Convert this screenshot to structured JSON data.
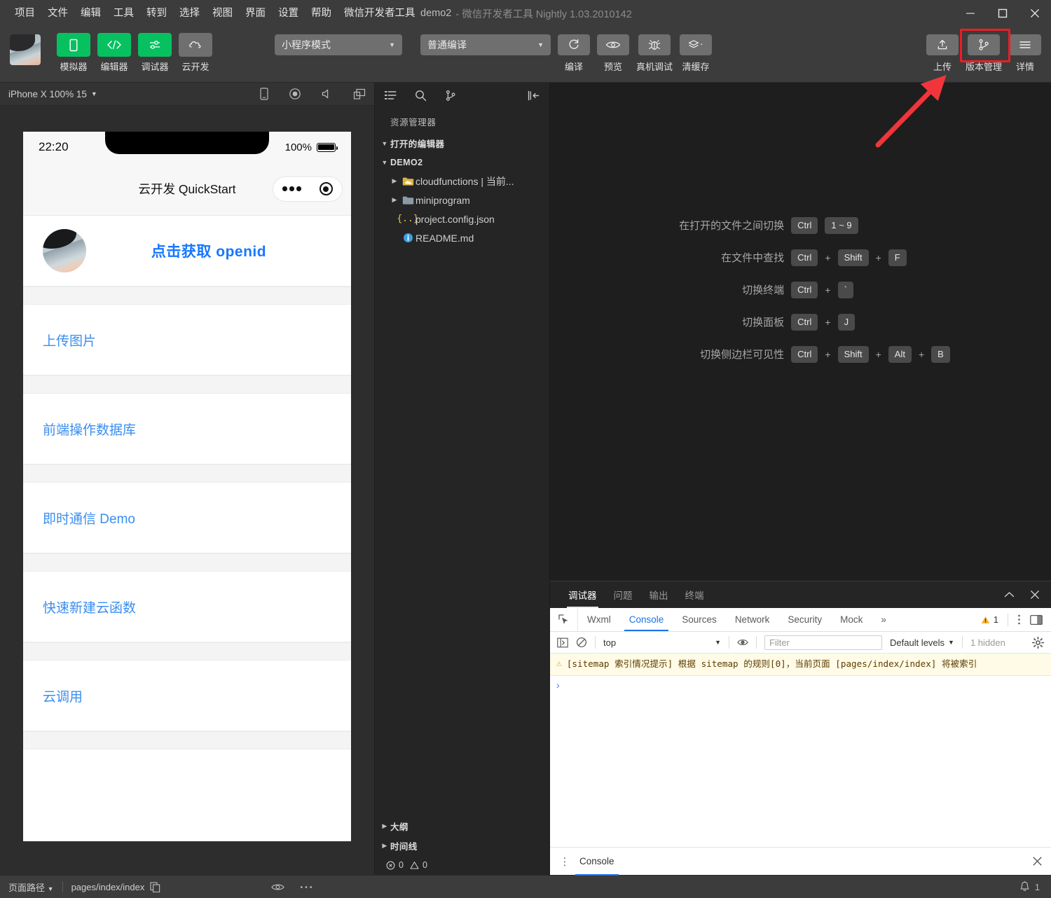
{
  "titlebar": {
    "menus": [
      "项目",
      "文件",
      "编辑",
      "工具",
      "转到",
      "选择",
      "视图",
      "界面",
      "设置",
      "帮助",
      "微信开发者工具"
    ],
    "project_name": "demo2",
    "app_name": "- 微信开发者工具 Nightly 1.03.2010142",
    "minimize": "–",
    "maximize": "□",
    "close": "✕"
  },
  "toolbar": {
    "buttons": [
      {
        "label": "模拟器",
        "icon": "phone-icon",
        "style": "green"
      },
      {
        "label": "编辑器",
        "icon": "code-icon",
        "style": "green"
      },
      {
        "label": "调试器",
        "icon": "debug-slider-icon",
        "style": "green"
      },
      {
        "label": "云开发",
        "icon": "cloud-icon",
        "style": "gray"
      }
    ],
    "mode_select": "小程序模式",
    "compile_select": "普通编译",
    "actions": [
      {
        "label": "编译",
        "icon": "refresh-icon"
      },
      {
        "label": "预览",
        "icon": "eye-icon"
      },
      {
        "label": "真机调试",
        "icon": "bug-icon"
      },
      {
        "label": "清缓存",
        "icon": "layers-icon"
      }
    ],
    "right_actions": [
      {
        "label": "上传",
        "icon": "upload-icon",
        "highlighted": false
      },
      {
        "label": "版本管理",
        "icon": "git-branch-icon",
        "highlighted": true
      },
      {
        "label": "详情",
        "icon": "hamburger-icon",
        "highlighted": false
      }
    ]
  },
  "simulator": {
    "device_label": "iPhone X 100% 15",
    "icons": [
      "phone-rotate-icon",
      "record-icon",
      "mute-icon",
      "multi-window-icon"
    ],
    "phone": {
      "time": "22:20",
      "battery_percent": "100%",
      "nav_title": "云开发 QuickStart",
      "openid_label": "点击获取 openid",
      "cells": [
        "上传图片",
        "前端操作数据库",
        "即时通信 Demo",
        "快速新建云函数",
        "云调用"
      ]
    }
  },
  "explorer": {
    "icons": [
      "explorer-icon",
      "search-icon",
      "source-control-icon",
      "collapse-sidebar-icon"
    ],
    "header": "资源管理器",
    "sections": [
      {
        "label": "打开的编辑器",
        "expanded": true
      },
      {
        "label": "DEMO2",
        "expanded": true
      }
    ],
    "files": [
      {
        "name": "cloudfunctions | 当前...",
        "type": "cloud-folder",
        "expanded": false
      },
      {
        "name": "miniprogram",
        "type": "folder",
        "expanded": false
      },
      {
        "name": "project.config.json",
        "type": "json"
      },
      {
        "name": "README.md",
        "type": "markdown"
      }
    ],
    "footer_sections": [
      "大纲",
      "时间线"
    ],
    "problems": {
      "errors": "0",
      "warnings": "0"
    }
  },
  "welcome": {
    "shortcuts": [
      {
        "label": "在打开的文件之间切换",
        "keys": [
          "Ctrl",
          "1 ~ 9"
        ],
        "joiners": [
          ""
        ]
      },
      {
        "label": "在文件中查找",
        "keys": [
          "Ctrl",
          "Shift",
          "F"
        ],
        "joiners": [
          "+",
          "+"
        ]
      },
      {
        "label": "切换终端",
        "keys": [
          "Ctrl",
          "`"
        ],
        "joiners": [
          "+"
        ]
      },
      {
        "label": "切换面板",
        "keys": [
          "Ctrl",
          "J"
        ],
        "joiners": [
          "+"
        ]
      },
      {
        "label": "切换侧边栏可见性",
        "keys": [
          "Ctrl",
          "Shift",
          "Alt",
          "B"
        ],
        "joiners": [
          "+",
          "+",
          "+"
        ]
      }
    ]
  },
  "debugger": {
    "panel_tabs": [
      {
        "label": "调试器",
        "active": true
      },
      {
        "label": "问题",
        "active": false
      },
      {
        "label": "输出",
        "active": false
      },
      {
        "label": "终端",
        "active": false
      }
    ],
    "panel_actions": [
      "collapse-icon",
      "close-icon"
    ],
    "devtools_tabs": [
      {
        "label": "Wxml",
        "active": false
      },
      {
        "label": "Console",
        "active": true
      },
      {
        "label": "Sources",
        "active": false
      },
      {
        "label": "Network",
        "active": false
      },
      {
        "label": "Security",
        "active": false
      },
      {
        "label": "Mock",
        "active": false
      }
    ],
    "more_tabs": "»",
    "warning_count": "1",
    "console_toolbar": {
      "context": "top",
      "filter_placeholder": "Filter",
      "levels": "Default levels",
      "hidden": "1 hidden"
    },
    "console_message": "[sitemap 索引情况提示] 根据 sitemap 的规则[0]，当前页面 [pages/index/index] 将被索引",
    "prompt": "›",
    "drawer_tab": "Console"
  },
  "statusbar": {
    "page_path_label": "页面路径",
    "page_path": "pages/index/index",
    "copy_icon": "copy-icon",
    "eye_icon": "eye-icon",
    "more_icon": "more-icon",
    "notification_count": "1"
  },
  "colors": {
    "accent_green": "#07c160",
    "link_blue": "#3a8ef0",
    "openid_blue": "#1677ff",
    "highlight_red": "#ee1c25",
    "devtools_blue": "#1a73e8",
    "warning_yellow": "#e8a33d"
  }
}
